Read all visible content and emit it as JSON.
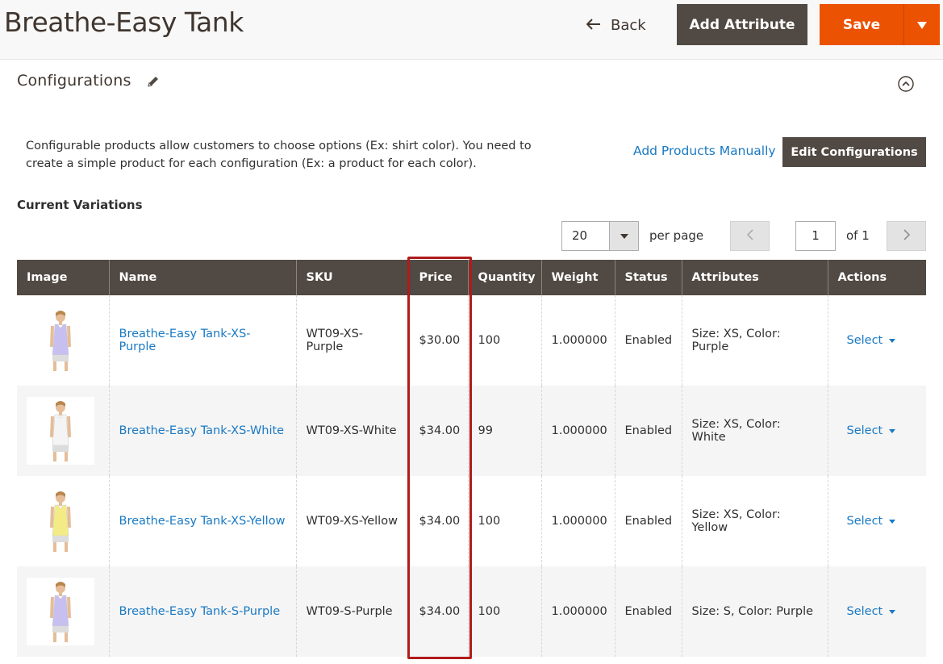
{
  "header": {
    "title": "Breathe-Easy Tank",
    "back_label": "Back",
    "add_attribute_label": "Add Attribute",
    "save_label": "Save"
  },
  "configurations": {
    "title": "Configurations",
    "description": "Configurable products allow customers to choose options (Ex: shirt color). You need to create a simple product for each configuration (Ex: a product for each color).",
    "add_manually_label": "Add Products Manually",
    "edit_configurations_label": "Edit Configurations",
    "current_variations_label": "Current Variations"
  },
  "pager": {
    "per_page_value": "20",
    "per_page_label": "per page",
    "current_page": "1",
    "of_label": "of 1"
  },
  "table": {
    "columns": [
      "Image",
      "Name",
      "SKU",
      "Price",
      "Quantity",
      "Weight",
      "Status",
      "Attributes",
      "Actions"
    ],
    "rows": [
      {
        "name": "Breathe-Easy Tank-XS-Purple",
        "sku": "WT09-XS-Purple",
        "price": "$30.00",
        "quantity": "100",
        "weight": "1.000000",
        "status": "Enabled",
        "attributes": "Size: XS, Color: Purple",
        "action": "Select",
        "tank_color": "#c7bff0"
      },
      {
        "name": "Breathe-Easy Tank-XS-White",
        "sku": "WT09-XS-White",
        "price": "$34.00",
        "quantity": "99",
        "weight": "1.000000",
        "status": "Enabled",
        "attributes": "Size: XS, Color: White",
        "action": "Select",
        "tank_color": "#f4f4f4"
      },
      {
        "name": "Breathe-Easy Tank-XS-Yellow",
        "sku": "WT09-XS-Yellow",
        "price": "$34.00",
        "quantity": "100",
        "weight": "1.000000",
        "status": "Enabled",
        "attributes": "Size: XS, Color: Yellow",
        "action": "Select",
        "tank_color": "#f3ec86"
      },
      {
        "name": "Breathe-Easy Tank-S-Purple",
        "sku": "WT09-S-Purple",
        "price": "$34.00",
        "quantity": "100",
        "weight": "1.000000",
        "status": "Enabled",
        "attributes": "Size: S, Color: Purple",
        "action": "Select",
        "tank_color": "#c7bff0"
      }
    ]
  },
  "colors": {
    "accent": "#eb5202",
    "dark_button": "#514943",
    "link": "#1979c3",
    "highlight_box": "#b01b1b"
  }
}
